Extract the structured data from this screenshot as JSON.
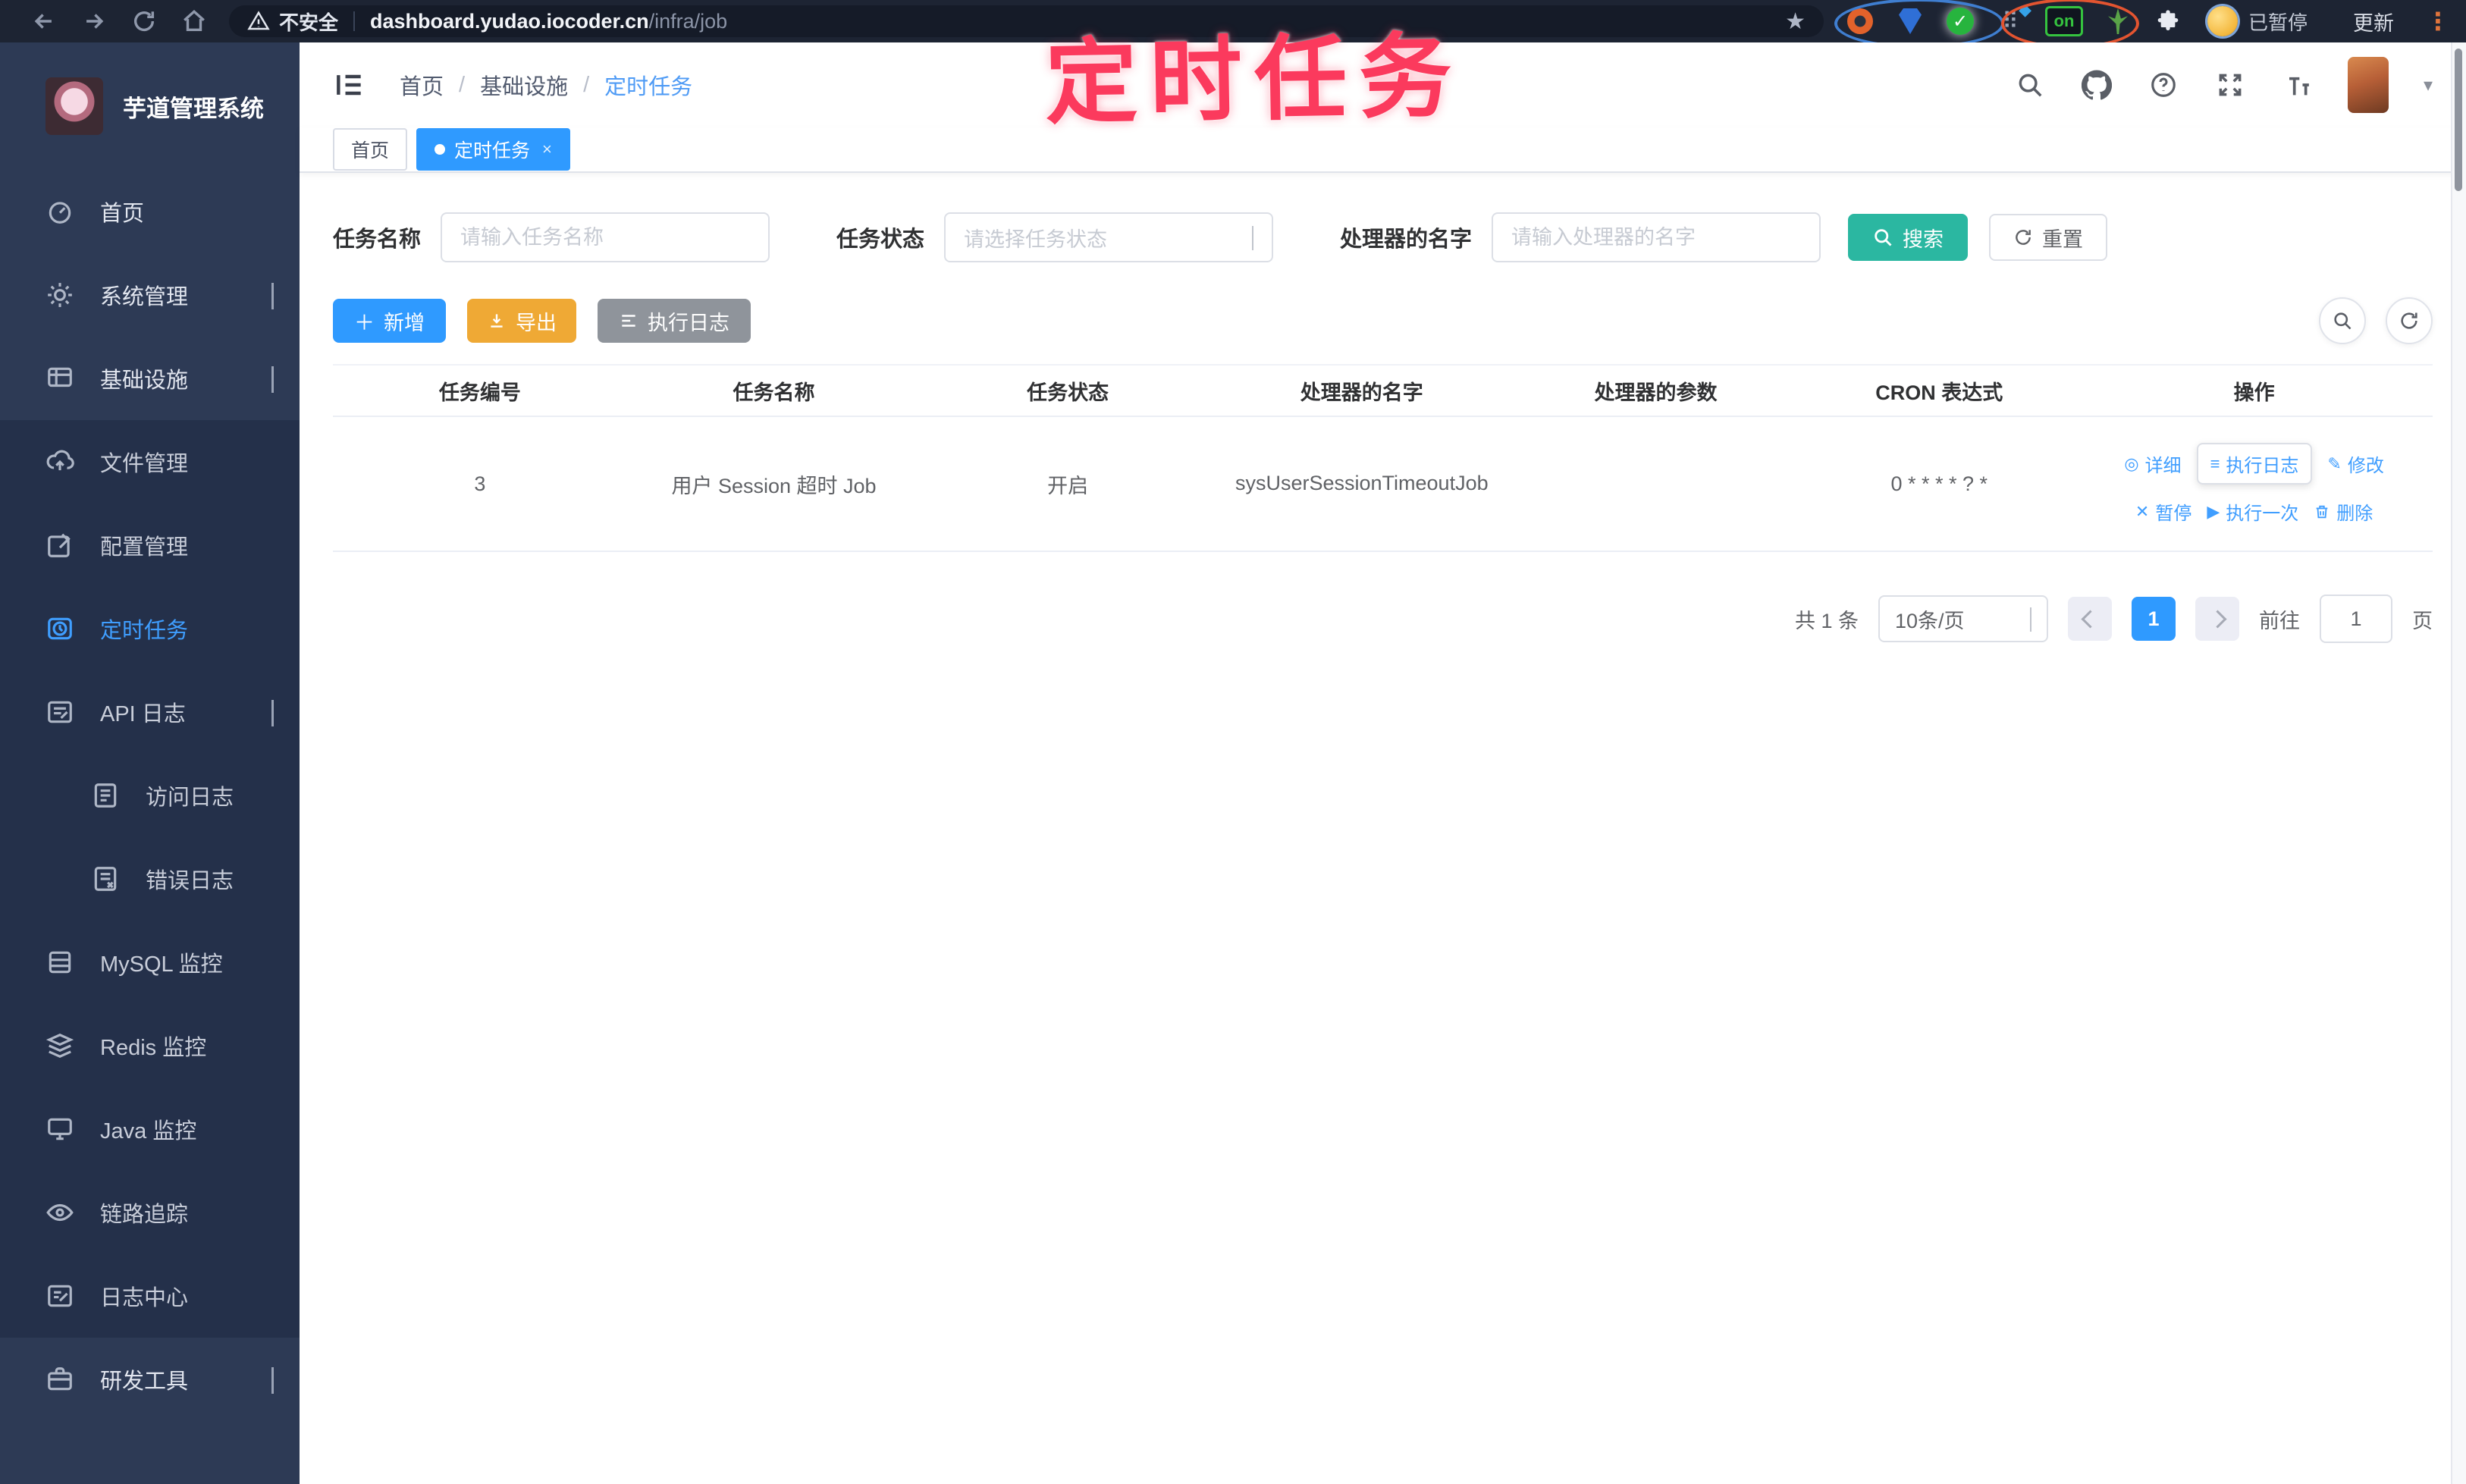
{
  "annotation": {
    "title": "定时任务",
    "color": "#fb3a5d"
  },
  "browser": {
    "warning": "不安全",
    "host": "dashboard.yudao.iocoder.cn",
    "path": "/infra/job",
    "on_badge": "on",
    "profile_status": "已暂停",
    "update_label": "更新"
  },
  "sidebar": {
    "logo_title": "芋道管理系统",
    "menu": [
      {
        "label": "首页"
      },
      {
        "label": "系统管理"
      },
      {
        "label": "基础设施"
      },
      {
        "label": "文件管理"
      },
      {
        "label": "配置管理"
      },
      {
        "label": "定时任务"
      },
      {
        "label": "API 日志"
      },
      {
        "label": "访问日志"
      },
      {
        "label": "错误日志"
      },
      {
        "label": "MySQL 监控"
      },
      {
        "label": "Redis 监控"
      },
      {
        "label": "Java 监控"
      },
      {
        "label": "链路追踪"
      },
      {
        "label": "日志中心"
      },
      {
        "label": "研发工具"
      }
    ]
  },
  "header": {
    "breadcrumb": [
      "首页",
      "基础设施",
      "定时任务"
    ],
    "separator": "/"
  },
  "tabs": [
    {
      "label": "首页"
    },
    {
      "label": "定时任务",
      "close": "×"
    }
  ],
  "filters": {
    "task_name": {
      "label": "任务名称",
      "placeholder": "请输入任务名称"
    },
    "task_status": {
      "label": "任务状态",
      "placeholder": "请选择任务状态"
    },
    "handler_name": {
      "label": "处理器的名字",
      "placeholder": "请输入处理器的名字"
    },
    "search_label": "搜索",
    "reset_label": "重置"
  },
  "toolbar": {
    "add_label": "新增",
    "export_label": "导出",
    "exec_log_label": "执行日志"
  },
  "table": {
    "columns": [
      "任务编号",
      "任务名称",
      "任务状态",
      "处理器的名字",
      "处理器的参数",
      "CRON 表达式",
      "操作"
    ],
    "rows": [
      {
        "id": "3",
        "name": "用户 Session 超时 Job",
        "status": "开启",
        "handler": "sysUserSessionTimeoutJob",
        "params": "",
        "cron": "0 * * * * ? *",
        "actions": {
          "detail": "详细",
          "job_log": "执行日志",
          "edit": "修改",
          "pause": "暂停",
          "run_once": "执行一次",
          "delete": "删除"
        }
      }
    ]
  },
  "pagination": {
    "total": "共 1 条",
    "page_size": "10条/页",
    "current_page": "1",
    "goto_label": "前往",
    "goto_value": "1",
    "page_unit": "页"
  },
  "colors": {
    "accent": "#409eff",
    "search_teal": "#2bb7a1",
    "export_orange": "#e6a23c",
    "info_gray": "#909399",
    "sidebar_bg": "#2d3a55",
    "submenu_bg": "#24304a",
    "annotation_pink": "#fb3a5d"
  }
}
